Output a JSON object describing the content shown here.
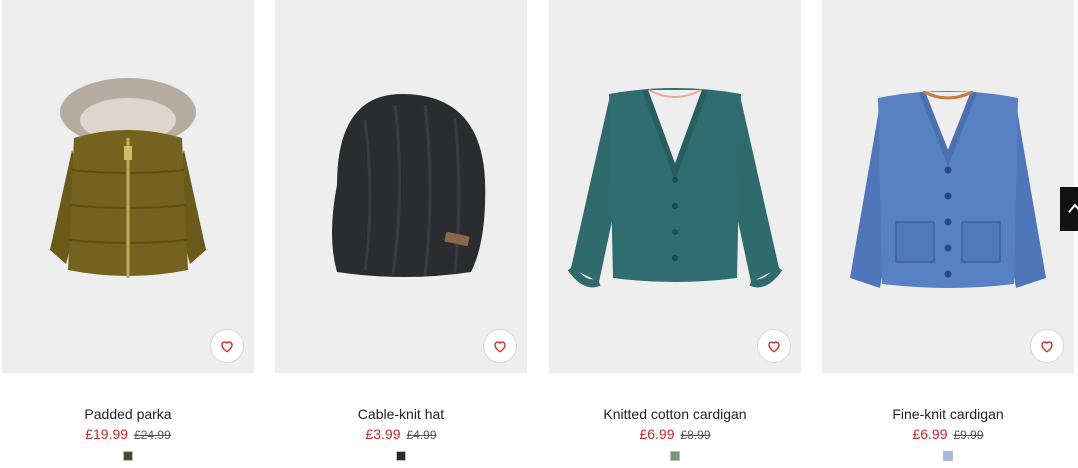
{
  "products": [
    {
      "name": "Padded parka",
      "sale_price": "£19.99",
      "old_price": "£24.99",
      "swatch_color": "#4f4a33",
      "image_icon": "padded-parka-image"
    },
    {
      "name": "Cable-knit hat",
      "sale_price": "£3.99",
      "old_price": "£4.99",
      "swatch_color": "#2a2a2c",
      "image_icon": "cable-knit-hat-image"
    },
    {
      "name": "Knitted cotton cardigan",
      "sale_price": "£6.99",
      "old_price": "£8.99",
      "swatch_color": "#7a9576",
      "image_icon": "knitted-cotton-cardigan-image"
    },
    {
      "name": "Fine-knit cardigan",
      "sale_price": "£6.99",
      "old_price": "£9.99",
      "swatch_color": "#aab6de",
      "image_icon": "fine-knit-cardigan-image"
    }
  ],
  "colors": {
    "sale": "#c9282d",
    "image_background": "#eeeeee"
  },
  "icons": {
    "favorite": "heart-icon",
    "scroll_top": "chevron-up-icon"
  }
}
